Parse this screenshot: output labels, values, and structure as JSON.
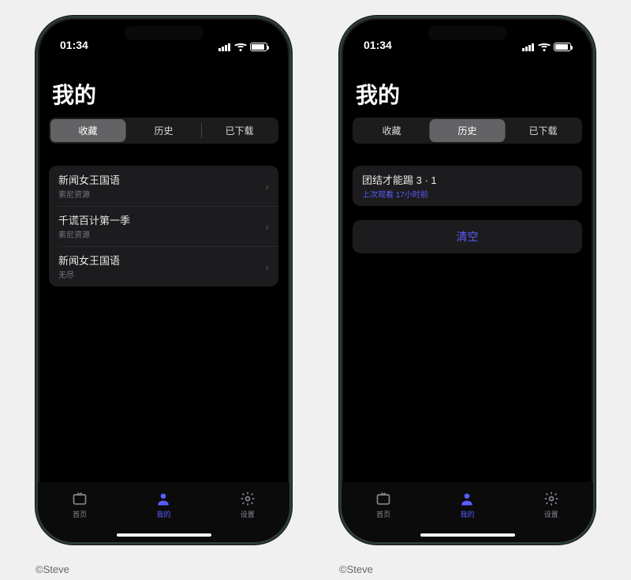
{
  "status_time": "01:34",
  "page_title": "我的",
  "segments": [
    "收藏",
    "历史",
    "已下载"
  ],
  "left_phone": {
    "active_segment": 0,
    "list": [
      {
        "title": "新闻女王国语",
        "sub": "索尼资源"
      },
      {
        "title": "千谎百计第一季",
        "sub": "索尼资源"
      },
      {
        "title": "新闻女王国语",
        "sub": "无尽"
      }
    ]
  },
  "right_phone": {
    "active_segment": 1,
    "list": [
      {
        "title": "团结才能踢 3 · 1",
        "sub": "上次观看 17小时前"
      }
    ],
    "clear_label": "清空"
  },
  "tabbar": {
    "home": "首页",
    "mine": "我的",
    "settings": "设置"
  },
  "watermark": "©Steve",
  "colors": {
    "accent": "#5a5cff"
  }
}
